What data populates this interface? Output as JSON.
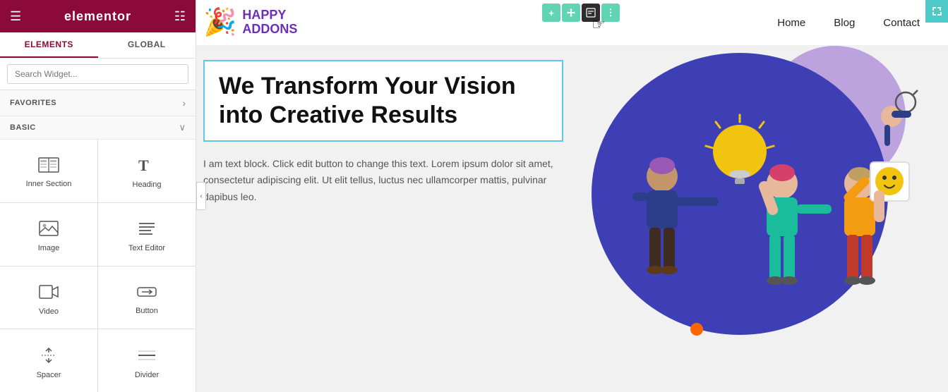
{
  "panel": {
    "header": {
      "logo": "elementor",
      "hamburger_unicode": "☰",
      "grid_unicode": "⊞"
    },
    "tabs": [
      {
        "id": "elements",
        "label": "ELEMENTS",
        "active": true
      },
      {
        "id": "global",
        "label": "GLOBAL",
        "active": false
      }
    ],
    "search": {
      "placeholder": "Search Widget..."
    },
    "favorites": {
      "label": "FAVORITES",
      "chevron": "›"
    },
    "basic": {
      "label": "BASIC",
      "chevron": "∨"
    },
    "widgets": [
      {
        "id": "inner-section",
        "label": "Inner Section",
        "icon": "inner-section-icon"
      },
      {
        "id": "heading",
        "label": "Heading",
        "icon": "heading-icon"
      },
      {
        "id": "image",
        "label": "Image",
        "icon": "image-icon"
      },
      {
        "id": "text-editor",
        "label": "Text Editor",
        "icon": "text-editor-icon"
      },
      {
        "id": "video",
        "label": "Video",
        "icon": "video-icon"
      },
      {
        "id": "button",
        "label": "Button",
        "icon": "button-icon"
      },
      {
        "id": "spacer",
        "label": "Spacer",
        "icon": "spacer-icon"
      },
      {
        "id": "divider",
        "label": "Divider",
        "icon": "divider-icon"
      }
    ]
  },
  "preview": {
    "nav": {
      "logo_happy": "HAPPY",
      "logo_addons": "ADDONS",
      "logo_emoji": "🎉",
      "links": [
        "Home",
        "Blog",
        "Contact"
      ]
    },
    "heading": "We Transform Your Vision into Creative Results",
    "body_text": "I am text block. Click edit button to change this text. Lorem ipsum dolor sit amet, consectetur adipiscing elit. Ut elit tellus, luctus nec ullamcorper mattis, pulvinar dapibus leo.",
    "toolbar": {
      "plus": "+",
      "move": "⤢",
      "edit": "✎",
      "dots": "⋮"
    }
  },
  "colors": {
    "brand": "#8b0a3a",
    "accent_teal": "#61d4b3",
    "logo_purple": "#6c2eb9",
    "blue_border": "#5bc8f0",
    "illustration_blue": "#3f3fb5"
  }
}
